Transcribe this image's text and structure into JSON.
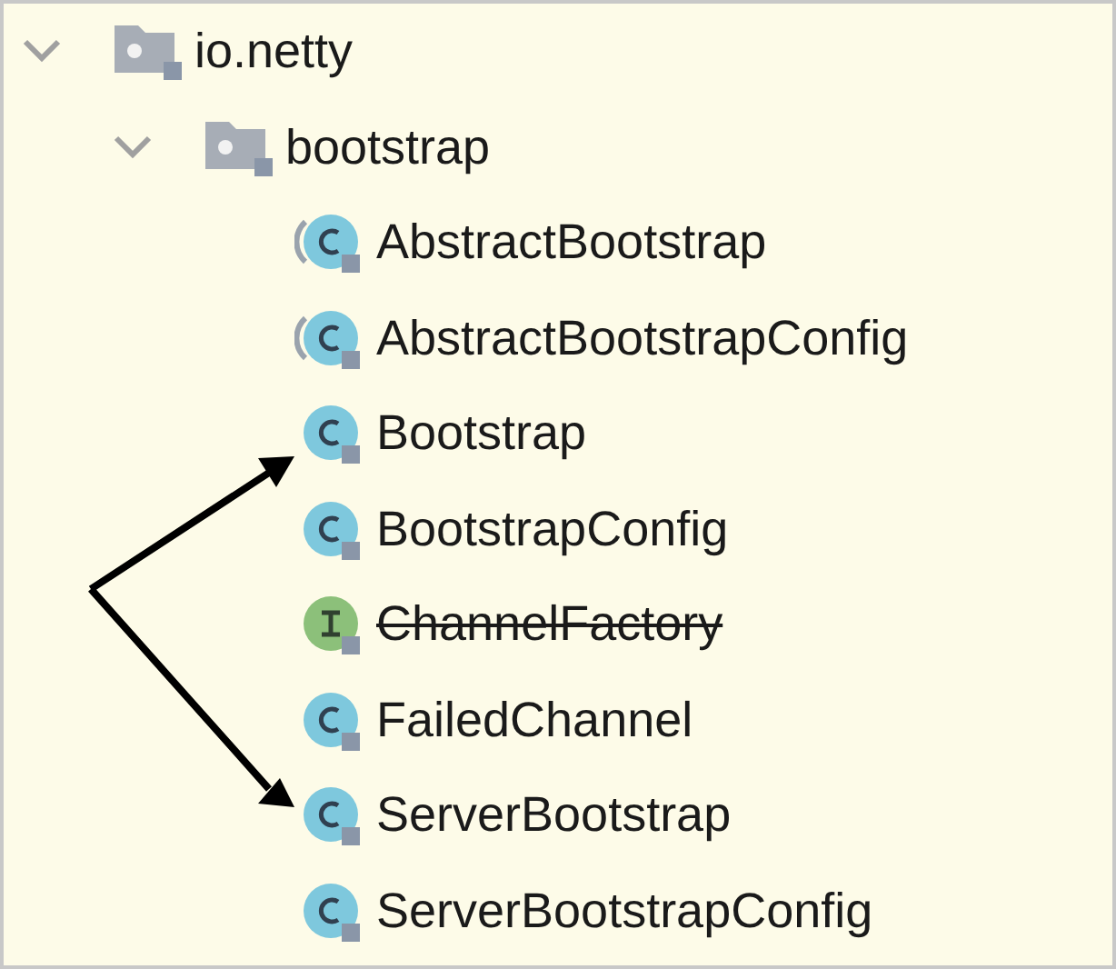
{
  "tree": [
    {
      "label": "io.netty",
      "kind": "package",
      "expanded": true,
      "children": [
        {
          "label": "bootstrap",
          "kind": "package",
          "expanded": true,
          "children": [
            {
              "label": "AbstractBootstrap",
              "kind": "abstract_class",
              "deprecated": false
            },
            {
              "label": "AbstractBootstrapConfig",
              "kind": "abstract_class",
              "deprecated": false
            },
            {
              "label": "Bootstrap",
              "kind": "class",
              "deprecated": false
            },
            {
              "label": "BootstrapConfig",
              "kind": "class",
              "deprecated": false
            },
            {
              "label": "ChannelFactory",
              "kind": "interface",
              "deprecated": true
            },
            {
              "label": "FailedChannel",
              "kind": "class",
              "deprecated": false
            },
            {
              "label": "ServerBootstrap",
              "kind": "class",
              "deprecated": false
            },
            {
              "label": "ServerBootstrapConfig",
              "kind": "class",
              "deprecated": false
            }
          ]
        }
      ]
    }
  ]
}
